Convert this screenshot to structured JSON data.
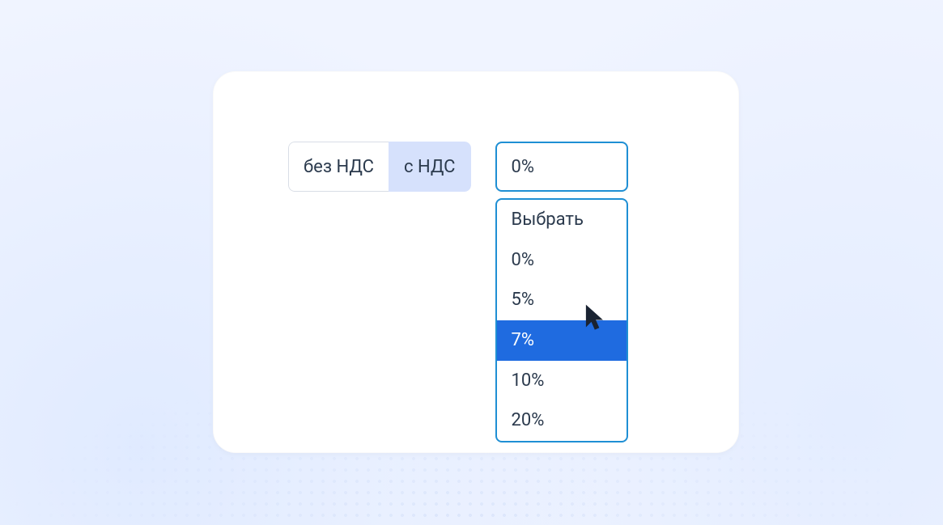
{
  "toggle": {
    "option_without": "без НДС",
    "option_with": "с НДС",
    "selected": "с НДС"
  },
  "select": {
    "current": "0%",
    "options": {
      "placeholder": "Выбрать",
      "opt0": "0%",
      "opt1": "5%",
      "opt2": "7%",
      "opt3": "10%",
      "opt4": "20%"
    },
    "highlighted": "7%"
  }
}
